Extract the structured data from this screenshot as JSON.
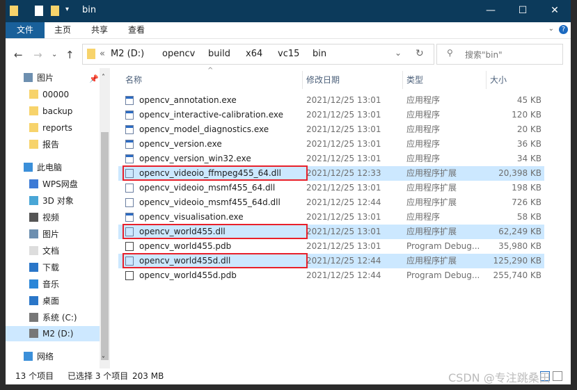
{
  "window": {
    "title": "bin"
  },
  "ribbon": {
    "tabs": [
      "文件",
      "主页",
      "共享",
      "查看"
    ]
  },
  "address": {
    "prefix": "«",
    "crumbs": [
      "M2 (D:)",
      "opencv",
      "build",
      "x64",
      "vc15",
      "bin"
    ]
  },
  "search": {
    "placeholder": "搜索\"bin\""
  },
  "sidebar": {
    "items": [
      {
        "label": "图片",
        "icon": "pictures-icon",
        "pinned": true
      },
      {
        "label": "00000",
        "icon": "folder-icon"
      },
      {
        "label": "backup",
        "icon": "folder-icon"
      },
      {
        "label": "reports",
        "icon": "folder-icon"
      },
      {
        "label": "报告",
        "icon": "folder-icon"
      },
      {
        "label": "此电脑",
        "icon": "computer-icon"
      },
      {
        "label": "WPS网盘",
        "icon": "cloud-icon"
      },
      {
        "label": "3D 对象",
        "icon": "3d-icon"
      },
      {
        "label": "视频",
        "icon": "video-icon"
      },
      {
        "label": "图片",
        "icon": "pictures-icon"
      },
      {
        "label": "文档",
        "icon": "document-icon"
      },
      {
        "label": "下载",
        "icon": "download-icon"
      },
      {
        "label": "音乐",
        "icon": "music-icon"
      },
      {
        "label": "桌面",
        "icon": "desktop-icon"
      },
      {
        "label": "系统 (C:)",
        "icon": "drive-icon"
      },
      {
        "label": "M2 (D:)",
        "icon": "drive-icon",
        "selected": true
      },
      {
        "label": "网络",
        "icon": "network-icon"
      }
    ]
  },
  "columns": [
    "名称",
    "修改日期",
    "类型",
    "大小"
  ],
  "files": [
    {
      "name": "opencv_annotation.exe",
      "date": "2021/12/25 13:01",
      "type": "应用程序",
      "size": "45 KB",
      "icon": "exe-icon"
    },
    {
      "name": "opencv_interactive-calibration.exe",
      "date": "2021/12/25 13:01",
      "type": "应用程序",
      "size": "120 KB",
      "icon": "exe-icon"
    },
    {
      "name": "opencv_model_diagnostics.exe",
      "date": "2021/12/25 13:01",
      "type": "应用程序",
      "size": "20 KB",
      "icon": "exe-icon"
    },
    {
      "name": "opencv_version.exe",
      "date": "2021/12/25 13:01",
      "type": "应用程序",
      "size": "36 KB",
      "icon": "exe-icon"
    },
    {
      "name": "opencv_version_win32.exe",
      "date": "2021/12/25 13:01",
      "type": "应用程序",
      "size": "34 KB",
      "icon": "exe-icon"
    },
    {
      "name": "opencv_videoio_ffmpeg455_64.dll",
      "date": "2021/12/25 12:33",
      "type": "应用程序扩展",
      "size": "20,398 KB",
      "icon": "dll-icon",
      "selected": true
    },
    {
      "name": "opencv_videoio_msmf455_64.dll",
      "date": "2021/12/25 13:01",
      "type": "应用程序扩展",
      "size": "198 KB",
      "icon": "dll-icon"
    },
    {
      "name": "opencv_videoio_msmf455_64d.dll",
      "date": "2021/12/25 12:44",
      "type": "应用程序扩展",
      "size": "726 KB",
      "icon": "dll-icon"
    },
    {
      "name": "opencv_visualisation.exe",
      "date": "2021/12/25 13:01",
      "type": "应用程序",
      "size": "58 KB",
      "icon": "exe-icon"
    },
    {
      "name": "opencv_world455.dll",
      "date": "2021/12/25 13:01",
      "type": "应用程序扩展",
      "size": "62,249 KB",
      "icon": "dll-icon",
      "selected": true
    },
    {
      "name": "opencv_world455.pdb",
      "date": "2021/12/25 13:01",
      "type": "Program Debug...",
      "size": "35,980 KB",
      "icon": "pdb-icon"
    },
    {
      "name": "opencv_world455d.dll",
      "date": "2021/12/25 12:44",
      "type": "应用程序扩展",
      "size": "125,290 KB",
      "icon": "dll-icon",
      "selected": true
    },
    {
      "name": "opencv_world455d.pdb",
      "date": "2021/12/25 12:44",
      "type": "Program Debug...",
      "size": "255,740 KB",
      "icon": "pdb-icon"
    }
  ],
  "status": {
    "count": "13 个项目",
    "selection": "已选择 3 个项目",
    "size": "203 MB"
  },
  "watermark": "CSDN @专注跳桑田",
  "colors": {
    "titlebar": "#0c3a5b",
    "file_tab": "#19609a",
    "selection": "#cce8ff",
    "highlight_box": "#e8202a"
  }
}
